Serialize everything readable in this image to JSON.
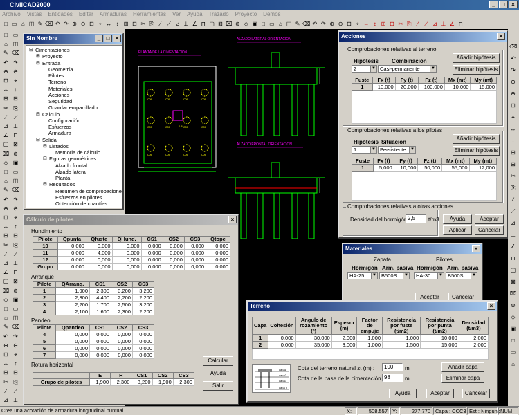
{
  "app": {
    "title": "CivilCAD2000"
  },
  "menu": [
    "Archivo",
    "Vistas",
    "Entidades",
    "Editar",
    "Armaduras",
    "Herramientas",
    "Ver",
    "Ayuda",
    "Trazado",
    "Proyecto",
    "Demos"
  ],
  "drawing": {
    "labels": [
      "PLANTA DE LA CIMENTACIÓN",
      "ALZADO LATERAL ORIENTACIÓN",
      "ALZADO FRONTAL ORIENTACIÓN"
    ],
    "pile_label": "C05",
    "center_label": "0.8"
  },
  "project": {
    "title": "Sin Nombre",
    "tree": [
      {
        "label": "Cimentaciones",
        "level": 0,
        "exp": "-"
      },
      {
        "label": "Proyecto",
        "level": 1,
        "exp": "+"
      },
      {
        "label": "Entrada",
        "level": 1,
        "exp": "-"
      },
      {
        "label": "Geometría",
        "level": 2
      },
      {
        "label": "Pilotes",
        "level": 2
      },
      {
        "label": "Terreno",
        "level": 2
      },
      {
        "label": "Materiales",
        "level": 2
      },
      {
        "label": "Acciones",
        "level": 2
      },
      {
        "label": "Seguridad",
        "level": 2
      },
      {
        "label": "Guardar emparrillado",
        "level": 2
      },
      {
        "label": "Calculo",
        "level": 1,
        "exp": "-"
      },
      {
        "label": "Configuración",
        "level": 2
      },
      {
        "label": "Esfuerzos",
        "level": 2
      },
      {
        "label": "Armadura",
        "level": 2
      },
      {
        "label": "Salida",
        "level": 1,
        "exp": "-"
      },
      {
        "label": "Listados",
        "level": 2,
        "exp": "-"
      },
      {
        "label": "Memoria de cálculo",
        "level": 3
      },
      {
        "label": "Figuras geométricas",
        "level": 2,
        "exp": "-"
      },
      {
        "label": "Alzado frontal",
        "level": 3
      },
      {
        "label": "Alzado lateral",
        "level": 3
      },
      {
        "label": "Planta",
        "level": 3
      },
      {
        "label": "Resultados",
        "level": 2,
        "exp": "-"
      },
      {
        "label": "Resumen de comprobaciones",
        "level": 3
      },
      {
        "label": "Esfuerzos en pilotes",
        "level": 3
      },
      {
        "label": "Obtención de cuantías",
        "level": 3
      }
    ]
  },
  "calculo": {
    "title": "Cálculo de pilotes",
    "hund": {
      "label": "Hundimiento",
      "headers": [
        "Pilote",
        "Qpunta",
        "Qfuste",
        "QHund.",
        "CS1",
        "CS2",
        "CS3",
        "Qtope"
      ],
      "rows": [
        [
          "10",
          "0,000",
          "0,000",
          "0,000",
          "0,000",
          "0,000",
          "0,000",
          "0,000"
        ],
        [
          "11",
          "0,000",
          "4,000",
          "0,000",
          "0,000",
          "0,000",
          "0,000",
          "0,000"
        ],
        [
          "12",
          "0,000",
          "0,000",
          "0,000",
          "0,000",
          "0,000",
          "0,000",
          "0,000"
        ],
        [
          "Grupo",
          "0,000",
          "0,000",
          "0,000",
          "0,000",
          "0,000",
          "0,000",
          "0,000"
        ]
      ]
    },
    "arr": {
      "label": "Arranque",
      "headers": [
        "Pilote",
        "QArranq.",
        "CS1",
        "CS2",
        "CS3"
      ],
      "rows": [
        [
          "1",
          "1,900",
          "2,300",
          "3,200",
          "3,200"
        ],
        [
          "2",
          "2,300",
          "4,400",
          "2,200",
          "2,200"
        ],
        [
          "3",
          "2,200",
          "1,700",
          "2,500",
          "3,200"
        ],
        [
          "4",
          "2,100",
          "1,600",
          "2,300",
          "2,200"
        ]
      ]
    },
    "pan": {
      "label": "Pandeo",
      "headers": [
        "Pilote",
        "Qpandeo",
        "CS1",
        "CS2",
        "CS3"
      ],
      "rows": [
        [
          "4",
          "0,000",
          "0,000",
          "0,000",
          "0,000"
        ],
        [
          "5",
          "0,000",
          "0,000",
          "0,000",
          "0,000"
        ],
        [
          "6",
          "0,000",
          "0,000",
          "0,000",
          "0,000"
        ],
        [
          "7",
          "0,000",
          "0,000",
          "0,000",
          "0,000"
        ]
      ]
    },
    "rot": {
      "label": "Rotura horizontal",
      "headers": [
        "",
        "E",
        "H",
        "CS1",
        "CS2",
        "CS3"
      ],
      "row": [
        "Grupo de pilotes",
        "1,900",
        "2,300",
        "3,200",
        "1,900",
        "2,300"
      ]
    },
    "buttons": [
      "Calcular",
      "Ayuda",
      "Salir"
    ]
  },
  "acciones": {
    "title": "Acciones",
    "terreno": {
      "label": "Comprobaciones relativas al terreno",
      "hyp_h": "Hipótesis",
      "comb_h": "Combinación",
      "hyp": "2",
      "comb": "Casi-permanente",
      "headers": [
        "Fuste",
        "Fx (t)",
        "Fy (t)",
        "Fz (t)",
        "Mx (mt)",
        "My (mt)"
      ],
      "row": [
        "1",
        "10,000",
        "20,000",
        "100,000",
        "10,000",
        "15,000"
      ]
    },
    "pilotes": {
      "label": "Comprobaciones relativas a los pilotes",
      "hyp_h": "Hipótesis",
      "sit_h": "Situación",
      "hyp": "1",
      "sit": "Persistente",
      "headers": [
        "Fuste",
        "Fx (t)",
        "Fy (t)",
        "Fz (t)",
        "Mx (mt)",
        "My (mt)"
      ],
      "row": [
        "1",
        "5,000",
        "10,000",
        "50,000",
        "55,000",
        "12,000"
      ]
    },
    "otras": {
      "label": "Comprobaciones relativas a otras acciones",
      "dens_label": "Densidad del hormigón :",
      "dens": "2,5",
      "unit": "t/m3"
    },
    "buttons": {
      "add": "Añadir hipótesis",
      "del": "Eliminar hipótesis",
      "help": "Ayuda",
      "accept": "Aceptar",
      "apply": "Aplicar",
      "cancel": "Cancelar"
    }
  },
  "materiales": {
    "title": "Materiales",
    "zapata": "Zapata",
    "pilotes": "Pilotes",
    "h_horm": "Hormigón",
    "h_arm": "Arm. pasiva",
    "z_horm": "HA-25",
    "z_arm": "B500S",
    "p_horm": "HA-30",
    "p_arm": "B500S",
    "accept": "Aceptar",
    "cancel": "Cancelar"
  },
  "terreno": {
    "title": "Terreno",
    "headers": [
      "Capa",
      "Cohesión",
      "Angulo de rozamiento (º)",
      "Espesor (m)",
      "Factor de empuje",
      "Resistencia por fuste (t/m2)",
      "Resistencia por punta (t/m2)",
      "Densidad (t/m3)"
    ],
    "rows": [
      [
        "1",
        "0,000",
        "30,000",
        "2,000",
        "1,000",
        "1,000",
        "10,000",
        "2,000"
      ],
      [
        "2",
        "0,000",
        "35,000",
        "3,000",
        "1,000",
        "1,500",
        "15,000",
        "2,000"
      ],
      [
        "3",
        "0,000",
        "30,000",
        "2,000",
        "1,000",
        "1,200",
        "10,000",
        "1,800"
      ]
    ],
    "cota_nat_label": "Cota del terreno natural  zt (m) :",
    "cota_nat": "100",
    "cota_base_label": "Cota de la base de la cimentación zc (m) :",
    "cota_base": "98",
    "unit_m": "m",
    "layers": [
      "capa1",
      "capa2",
      "capa3",
      "capa n"
    ],
    "buttons": {
      "add": "Añadir capa",
      "del": "Eliminar capa",
      "help": "Ayuda",
      "accept": "Aceptar",
      "cancel": "Cancelar"
    }
  },
  "status": {
    "message": "Crea una acotación de armadura longitudinal  puntual",
    "x_label": "X:",
    "x": "508.557",
    "y_label": "Y:",
    "y": "277.770",
    "capa": "Capa : CCC3",
    "est": "Est : Ninguno",
    "num": "NUM"
  }
}
